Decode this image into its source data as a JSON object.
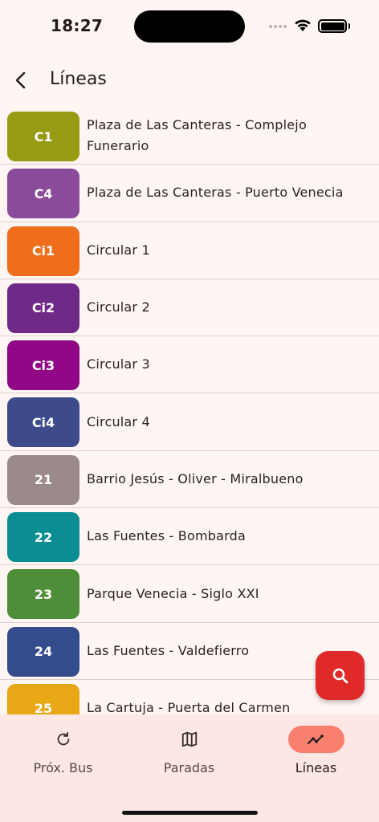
{
  "status_bar": {
    "time": "18:27"
  },
  "header": {
    "title": "Líneas",
    "back_icon": "chevron-left-icon"
  },
  "lines": [
    {
      "code": "C1",
      "name": "Plaza de Las Canteras - Complejo Funerario",
      "color": "#979a13"
    },
    {
      "code": "C4",
      "name": "Plaza de Las Canteras - Puerto Venecia",
      "color": "#8a4c9a"
    },
    {
      "code": "Ci1",
      "name": "Circular 1",
      "color": "#ee6e1c"
    },
    {
      "code": "Ci2",
      "name": "Circular 2",
      "color": "#6e2a86"
    },
    {
      "code": "Ci3",
      "name": "Circular 3",
      "color": "#910886"
    },
    {
      "code": "Ci4",
      "name": "Circular 4",
      "color": "#3d4b8a"
    },
    {
      "code": "21",
      "name": "Barrio Jesús - Oliver - Miralbueno",
      "color": "#9a8a8a"
    },
    {
      "code": "22",
      "name": "Las Fuentes - Bombarda",
      "color": "#0a8e93"
    },
    {
      "code": "23",
      "name": "Parque Venecia - Siglo XXI",
      "color": "#4f8e39"
    },
    {
      "code": "24",
      "name": "Las Fuentes - Valdefierro",
      "color": "#344c8c"
    },
    {
      "code": "25",
      "name": "La Cartuja - Puerta del Carmen",
      "color": "#e8a714"
    }
  ],
  "fab": {
    "icon": "search-icon",
    "color": "#e02a2a"
  },
  "bottom_nav": {
    "items": [
      {
        "label": "Próx. Bus",
        "icon": "refresh-icon",
        "active": false
      },
      {
        "label": "Paradas",
        "icon": "map-icon",
        "active": false
      },
      {
        "label": "Líneas",
        "icon": "trending-icon",
        "active": true
      }
    ]
  }
}
